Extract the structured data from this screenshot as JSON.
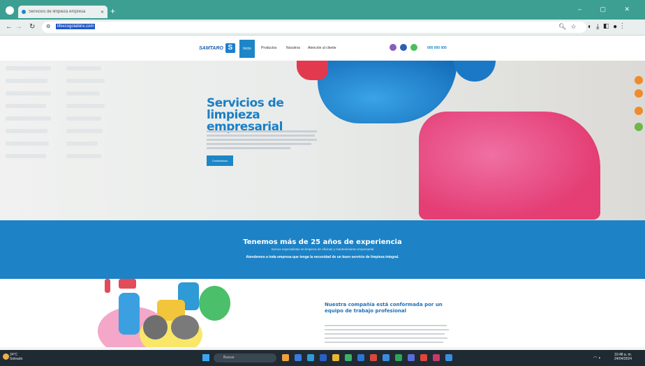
{
  "browser": {
    "tab_title": "Servicios de limpieza empresa",
    "tab_close": "✕",
    "new_tab": "+",
    "url": "lifexcogolabinx.com",
    "window_controls": "– ▢ ✕"
  },
  "site": {
    "logo_text": "SAMTARO",
    "nav": [
      "Inicio",
      "Productos",
      "Nosotros",
      "Atención al cliente"
    ],
    "phone": "000 000 000",
    "colors": {
      "brand": "#1c86c7",
      "pink": "#e4356f",
      "band": "#1d82c6"
    }
  },
  "hero": {
    "title": "Servicios de limpieza empresarial",
    "button": "Contáctanos"
  },
  "band": {
    "title": "Tenemos más de 25 años de experiencia",
    "subtitle": "Somos especialistas en limpieza de oficinas y mantenimiento empresarial",
    "strong": "Atendemos a toda empresa que tenga la necesidad de un buen servicio de limpieza integral."
  },
  "about": {
    "title": "Nuestra compañía está conformada por un equipo de trabajo profesional"
  },
  "taskbar": {
    "weather_temp": "24°C",
    "weather_desc": "Soleado",
    "search": "Buscar",
    "time": "10:48 a. m.",
    "date": "24/04/2024"
  }
}
